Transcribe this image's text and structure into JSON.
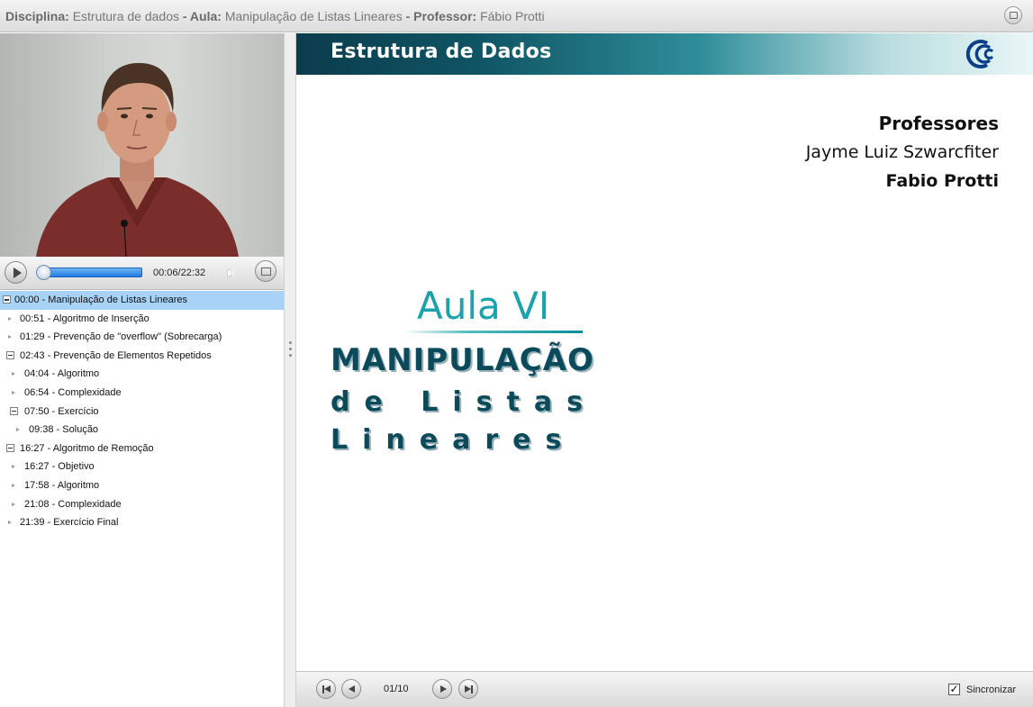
{
  "header": {
    "disciplina_label": "Disciplina:",
    "disciplina": "Estrutura de dados",
    "aula_label": "- Aula:",
    "aula": "Manipulação de Listas Lineares",
    "professor_label": "- Professor:",
    "professor": "Fábio Protti"
  },
  "player": {
    "time": "00:06/22:32",
    "progress": 0.004
  },
  "toc": [
    {
      "label": "00:00 - Manipulação de Listas Lineares",
      "level": 0,
      "type": "box",
      "selected": true
    },
    {
      "label": "00:51 - Algoritmo de Inserção",
      "level": 1,
      "type": "leaf"
    },
    {
      "label": "01:29 - Prevenção de \"overflow\" (Sobrecarga)",
      "level": 1,
      "type": "leaf"
    },
    {
      "label": "02:43 - Prevenção de Elementos Repetidos",
      "level": 1,
      "type": "box"
    },
    {
      "label": "04:04 - Algoritmo",
      "level": 2,
      "type": "leaf"
    },
    {
      "label": "06:54 - Complexidade",
      "level": 2,
      "type": "leaf"
    },
    {
      "label": "07:50 - Exercício",
      "level": 2,
      "type": "box"
    },
    {
      "label": "09:38 - Solução",
      "level": 3,
      "type": "leaf"
    },
    {
      "label": "16:27 - Algoritmo de Remoção",
      "level": 1,
      "type": "box"
    },
    {
      "label": "16:27 - Objetivo",
      "level": 2,
      "type": "leaf"
    },
    {
      "label": "17:58 - Algoritmo",
      "level": 2,
      "type": "leaf"
    },
    {
      "label": "21:08 - Complexidade",
      "level": 2,
      "type": "leaf"
    },
    {
      "label": "21:39 - Exercício Final",
      "level": 1,
      "type": "leaf"
    }
  ],
  "slide": {
    "banner_title": "Estrutura de Dados",
    "professors_heading": "Professores",
    "professor_1": "Jayme Luiz Szwarcfiter",
    "professor_2": "Fabio Protti",
    "aula": "Aula VI",
    "title_line1": "MANIPULAÇÃO",
    "title_line2": "de Listas",
    "title_line3": "Lineares"
  },
  "footer": {
    "page": "01/10",
    "sync_label": "Sincronizar",
    "sync_checked": true
  },
  "colors": {
    "accent_teal": "#1aa3ad",
    "title_dark_teal": "#0b4a5a",
    "selection": "#a9d3f6",
    "seek_blue": "#1f7be0"
  }
}
